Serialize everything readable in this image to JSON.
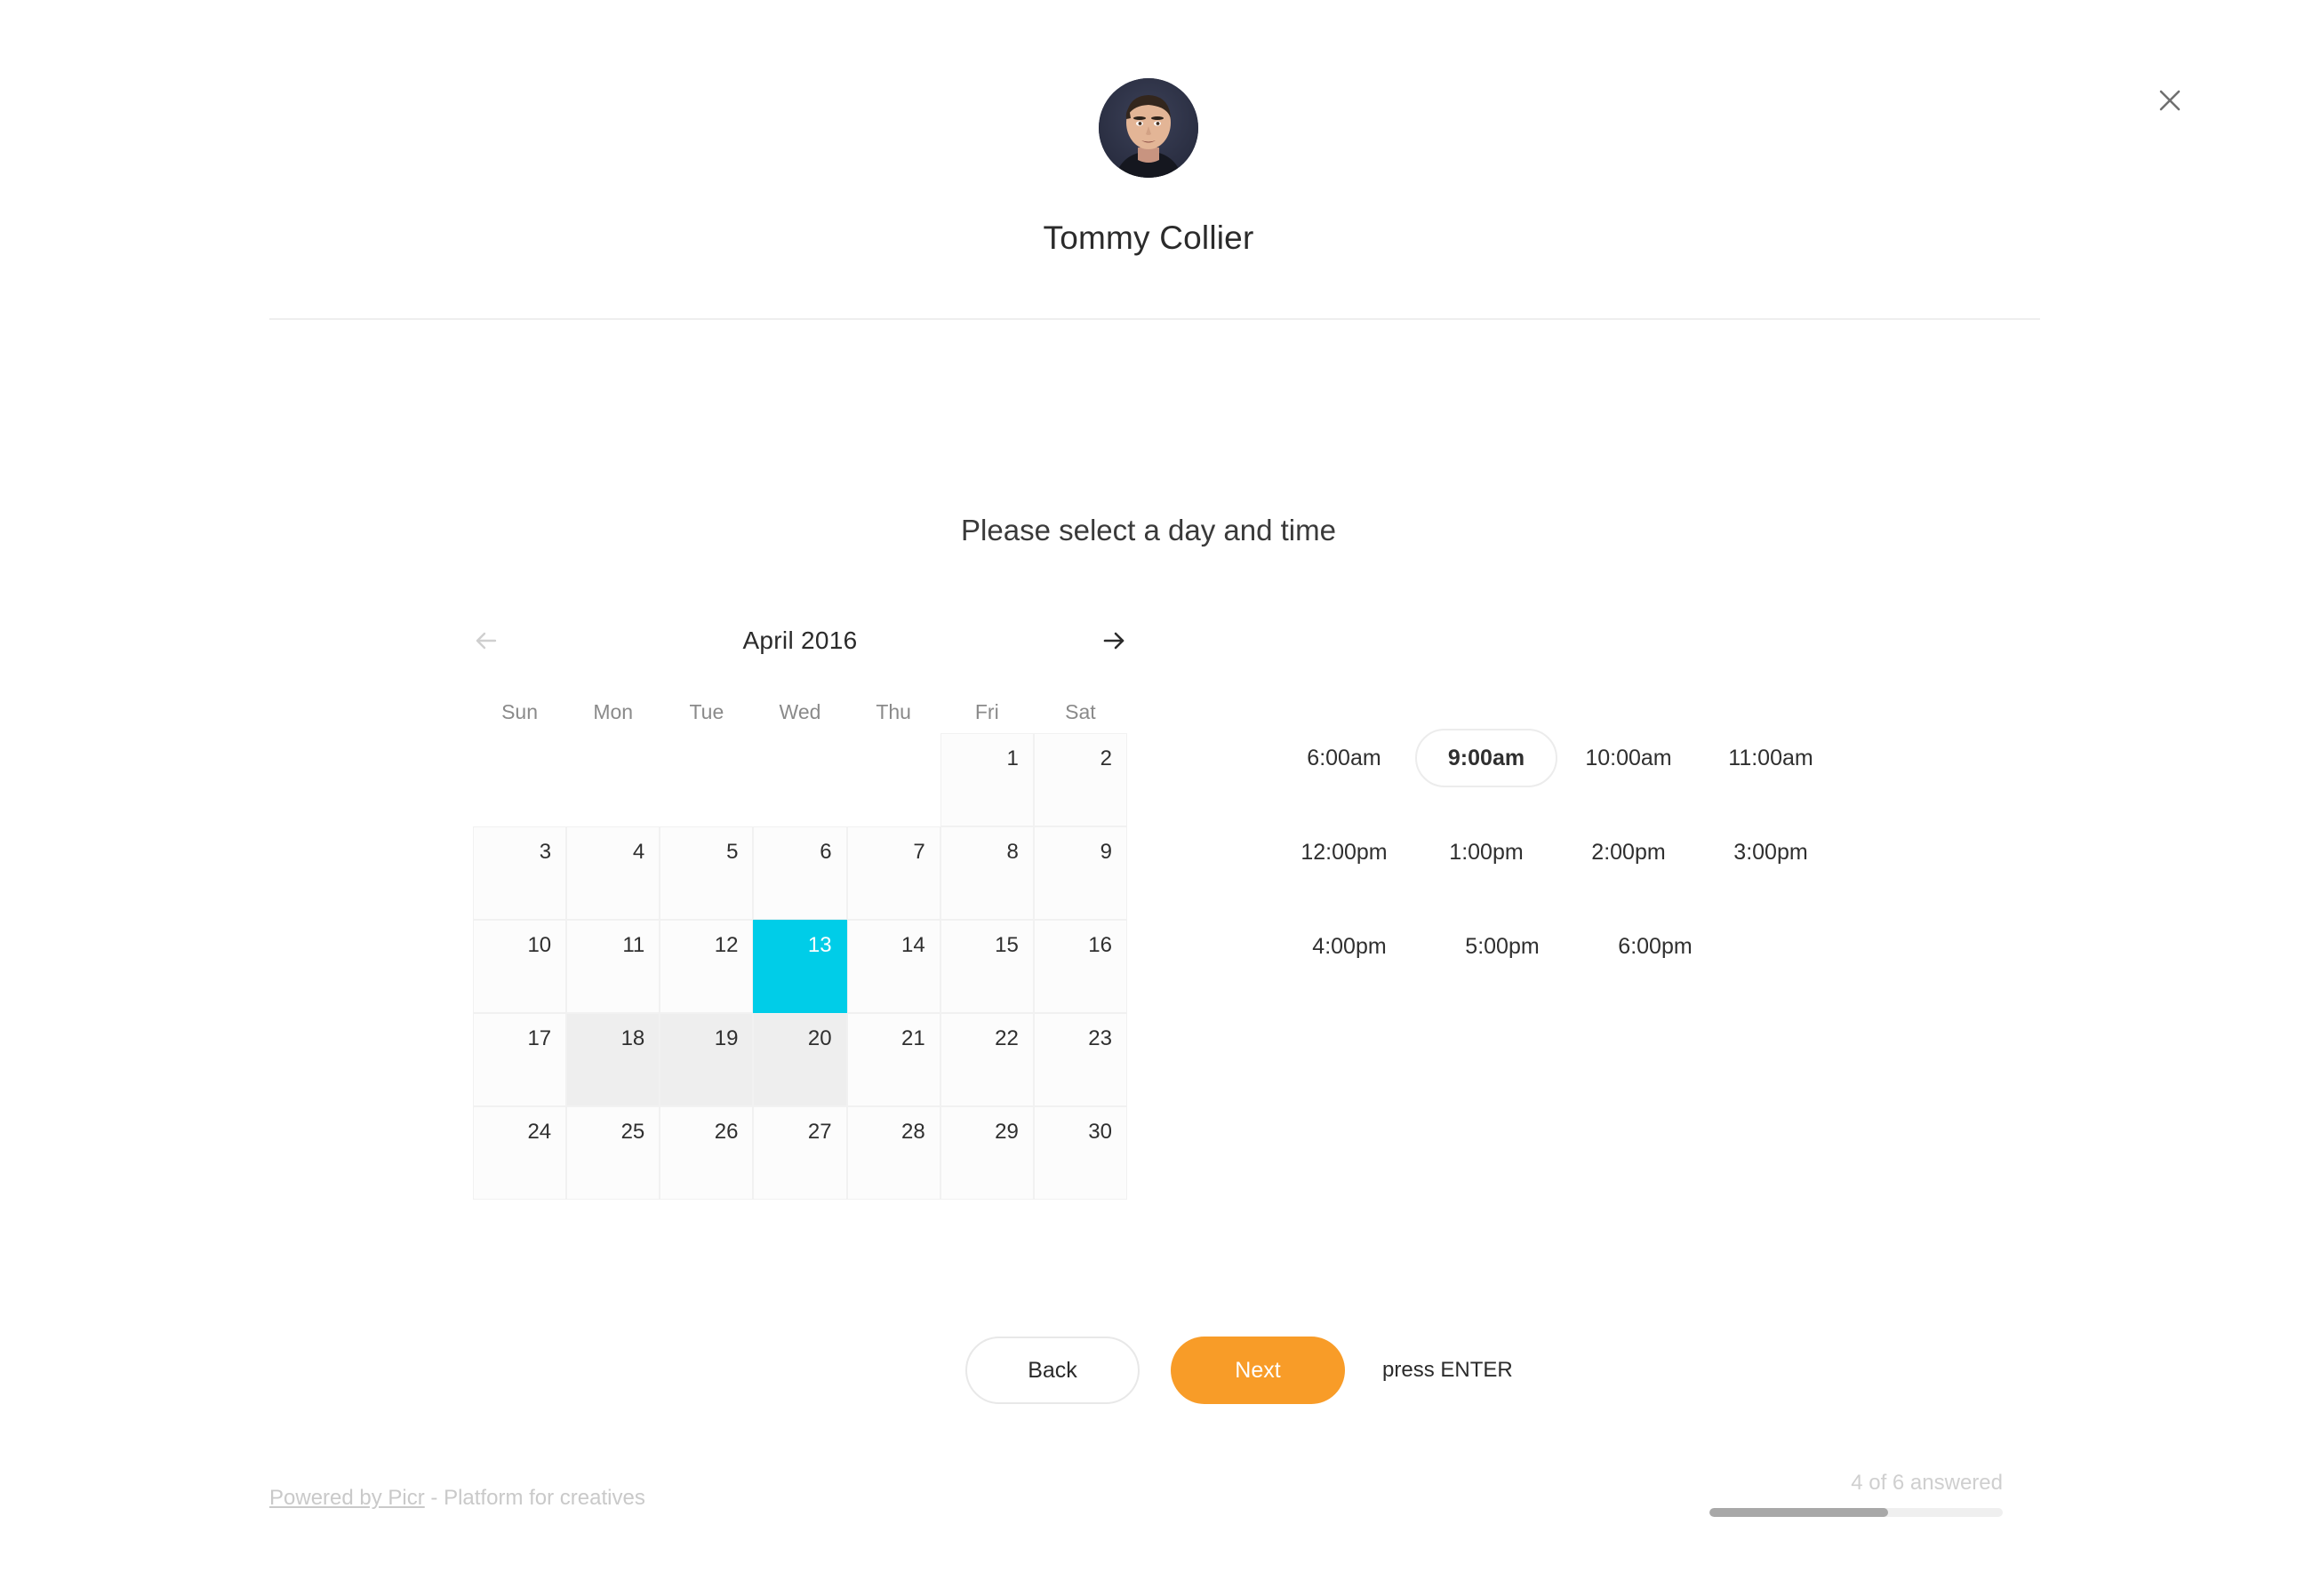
{
  "window": {
    "close_label": "×"
  },
  "profile": {
    "name": "Tommy Collier",
    "avatar_alt": "user-avatar"
  },
  "question": {
    "text": "Please select a day and time"
  },
  "calendar": {
    "title": "April 2016",
    "prev_label": "←",
    "next_label": "→",
    "weekdays": [
      "Sun",
      "Mon",
      "Tue",
      "Wed",
      "Thu",
      "Fri",
      "Sat"
    ],
    "selected_day": 13,
    "hovered_days": [
      18,
      19,
      20
    ],
    "leading_blanks": 5,
    "days": [
      1,
      2,
      3,
      4,
      5,
      6,
      7,
      8,
      9,
      10,
      11,
      12,
      13,
      14,
      15,
      16,
      17,
      18,
      19,
      20,
      21,
      22,
      23,
      24,
      25,
      26,
      27,
      28,
      29,
      30
    ],
    "selected_color": "#00cde8"
  },
  "times": {
    "selected": "9:00am",
    "rows": [
      [
        "6:00am",
        "9:00am",
        "10:00am",
        "11:00am"
      ],
      [
        "12:00pm",
        "1:00pm",
        "2:00pm",
        "3:00pm"
      ],
      [
        "4:00pm",
        "5:00pm",
        "6:00pm"
      ]
    ]
  },
  "actions": {
    "back_label": "Back",
    "next_label": "Next",
    "hint": "press ENTER",
    "next_color": "#f89c28"
  },
  "footer": {
    "powered_link": "Powered by Picr",
    "powered_rest": " - Platform for creatives",
    "progress_text": "4 of 6 answered",
    "progress_percent": 61
  }
}
